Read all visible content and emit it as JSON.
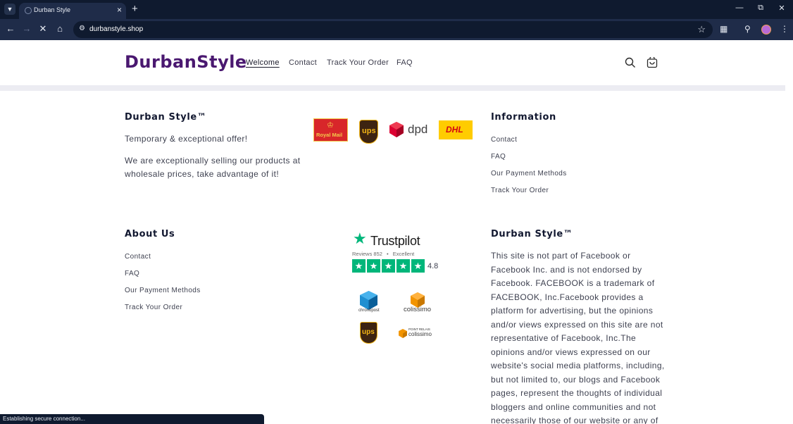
{
  "browser": {
    "tab_title": "Durban Style",
    "url": "durbanstyle.shop",
    "status_text": "Establishing secure connection..."
  },
  "header": {
    "logo": "DurbanStyle",
    "nav": [
      "Welcome",
      "Contact",
      "Track Your Order",
      "FAQ"
    ]
  },
  "col1": {
    "title": "Durban Style™",
    "line1": "Temporary & exceptional offer!",
    "line2a": "We are exceptionally selling our products at",
    "line2b": "wholesale prices, take advantage of it!"
  },
  "carriers": {
    "royal_mail": "Royal Mail",
    "ups": "ups",
    "dpd": "dpd",
    "dhl": "DHL",
    "chronopost": "chronopost",
    "colissimo": "colissimo",
    "point_relais": "POINT RELAIS"
  },
  "information": {
    "title": "Information",
    "links": [
      "Contact",
      "FAQ",
      "Our Payment Methods",
      "Track Your Order"
    ]
  },
  "about": {
    "title": "About Us",
    "links": [
      "Contact",
      "FAQ",
      "Our Payment Methods",
      "Track Your Order"
    ]
  },
  "trustpilot": {
    "name": "Trustpilot",
    "reviews_label": "Reviews 852",
    "bullet": "•",
    "rating_label": "Excellent",
    "score": "4.8",
    "stars": 5
  },
  "disclaimer": {
    "title": "Durban Style™",
    "lines": [
      "This site is not part of Facebook or",
      "Facebook Inc. and is not endorsed by",
      "Facebook. FACEBOOK is a trademark of",
      "FACEBOOK, Inc.Facebook provides a",
      "platform for advertising, but the opinions",
      "and/or views expressed on this site are not",
      "representative of Facebook, Inc.The",
      "opinions and/or views expressed on our",
      "website's social media platforms, including,",
      "but not limited to, our blogs and Facebook",
      "pages, represent the thoughts of individual",
      "bloggers and online communities and not",
      "necessarily those of our website or any of"
    ]
  },
  "colors": {
    "brand": "#4a1870",
    "trustpilot_green": "#00b67a",
    "chrome_dark": "#0f1a2f"
  }
}
